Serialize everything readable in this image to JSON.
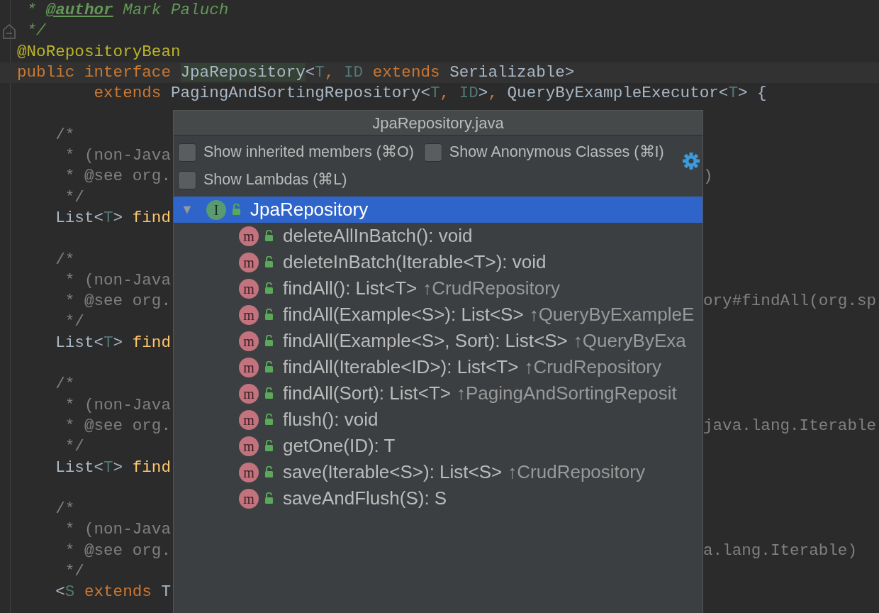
{
  "editor": {
    "lines": [
      {
        "tokens": [
          {
            "kind": "doc",
            "text": " * "
          },
          {
            "kind": "doctag",
            "text": "@author"
          },
          {
            "kind": "doc",
            "text": " Mark Paluch"
          }
        ]
      },
      {
        "fold": true,
        "tokens": [
          {
            "kind": "doc",
            "text": " */"
          }
        ]
      },
      {
        "tokens": [
          {
            "kind": "annotation",
            "text": "@NoRepositoryBean"
          }
        ]
      },
      {
        "current": true,
        "tokens": [
          {
            "kind": "keyword",
            "text": "public interface "
          },
          {
            "kind": "symbol",
            "text": "JpaRepository"
          },
          {
            "kind": "plain",
            "text": "<"
          },
          {
            "kind": "typeparam",
            "text": "T"
          },
          {
            "kind": "keyword",
            "text": ", "
          },
          {
            "kind": "typeparam",
            "text": "ID"
          },
          {
            "kind": "keyword",
            "text": " extends "
          },
          {
            "kind": "plain",
            "text": "Serializable>"
          }
        ]
      },
      {
        "tokens": [
          {
            "kind": "keyword",
            "text": "        extends "
          },
          {
            "kind": "plain",
            "text": "PagingAndSortingRepository<"
          },
          {
            "kind": "typeparam",
            "text": "T"
          },
          {
            "kind": "keyword",
            "text": ", "
          },
          {
            "kind": "typeparam",
            "text": "ID"
          },
          {
            "kind": "plain",
            "text": ">"
          },
          {
            "kind": "keyword",
            "text": ", "
          },
          {
            "kind": "plain",
            "text": "QueryByExampleExecutor<"
          },
          {
            "kind": "typeparam",
            "text": "T"
          },
          {
            "kind": "plain",
            "text": "> {"
          }
        ]
      },
      {
        "space_before": true,
        "tokens": [
          {
            "kind": "comment",
            "text": "    /*"
          }
        ]
      },
      {
        "tokens": [
          {
            "kind": "comment",
            "text": "     * (non-Java"
          }
        ]
      },
      {
        "tokens": [
          {
            "kind": "comment",
            "text": "     * @see org."
          }
        ],
        "right": ")"
      },
      {
        "tokens": [
          {
            "kind": "comment",
            "text": "     */"
          }
        ]
      },
      {
        "tokens": [
          {
            "kind": "plain",
            "text": "    List<"
          },
          {
            "kind": "typeparam",
            "text": "T"
          },
          {
            "kind": "plain",
            "text": "> "
          },
          {
            "kind": "method",
            "text": "find"
          }
        ]
      },
      {
        "space_before": true,
        "tokens": [
          {
            "kind": "comment",
            "text": "    /*"
          }
        ]
      },
      {
        "tokens": [
          {
            "kind": "comment",
            "text": "     * (non-Java"
          }
        ]
      },
      {
        "tokens": [
          {
            "kind": "comment",
            "text": "     * @see org."
          }
        ],
        "right": "ory#findAll(org.sp"
      },
      {
        "tokens": [
          {
            "kind": "comment",
            "text": "     */"
          }
        ]
      },
      {
        "tokens": [
          {
            "kind": "plain",
            "text": "    List<"
          },
          {
            "kind": "typeparam",
            "text": "T"
          },
          {
            "kind": "plain",
            "text": "> "
          },
          {
            "kind": "method",
            "text": "find"
          }
        ]
      },
      {
        "space_before": true,
        "tokens": [
          {
            "kind": "comment",
            "text": "    /*"
          }
        ]
      },
      {
        "tokens": [
          {
            "kind": "comment",
            "text": "     * (non-Java"
          }
        ]
      },
      {
        "tokens": [
          {
            "kind": "comment",
            "text": "     * @see org."
          }
        ],
        "right": "java.lang.Iterable"
      },
      {
        "tokens": [
          {
            "kind": "comment",
            "text": "     */"
          }
        ]
      },
      {
        "tokens": [
          {
            "kind": "plain",
            "text": "    List<"
          },
          {
            "kind": "typeparam",
            "text": "T"
          },
          {
            "kind": "plain",
            "text": "> "
          },
          {
            "kind": "method",
            "text": "find"
          }
        ]
      },
      {
        "space_before": true,
        "tokens": [
          {
            "kind": "comment",
            "text": "    /*"
          }
        ]
      },
      {
        "tokens": [
          {
            "kind": "comment",
            "text": "     * (non-Java"
          }
        ]
      },
      {
        "tokens": [
          {
            "kind": "comment",
            "text": "     * @see org."
          }
        ],
        "right": "a.lang.Iterable)"
      },
      {
        "tokens": [
          {
            "kind": "comment",
            "text": "     */"
          }
        ]
      },
      {
        "tokens": [
          {
            "kind": "plain",
            "text": "    <"
          },
          {
            "kind": "typeparam",
            "text": "S"
          },
          {
            "kind": "keyword",
            "text": " extends "
          },
          {
            "kind": "plain",
            "text": "T"
          }
        ]
      }
    ]
  },
  "popup": {
    "title": "JpaRepository.java",
    "options": [
      [
        {
          "label": "Show inherited members (⌘O)",
          "checked": false
        },
        {
          "label": "Show Anonymous Classes (⌘I)",
          "checked": false
        }
      ],
      [
        {
          "label": "Show Lambdas (⌘L)",
          "checked": false
        }
      ]
    ],
    "tree": [
      {
        "toggle": "▼",
        "badge": "I",
        "label": "JpaRepository",
        "selected": true,
        "children": [
          {
            "badge": "m",
            "label": "deleteAllInBatch(): void",
            "selected": false
          },
          {
            "badge": "m",
            "label": "deleteInBatch(Iterable<T>): void",
            "selected": false
          },
          {
            "badge": "m",
            "label": "findAll(): List<T>",
            "origin": "↑CrudRepository",
            "selected": false
          },
          {
            "badge": "m",
            "label": "findAll(Example<S>): List<S>",
            "origin": "↑QueryByExampleE",
            "selected": false
          },
          {
            "badge": "m",
            "label": "findAll(Example<S>, Sort): List<S>",
            "origin": "↑QueryByExa",
            "selected": false
          },
          {
            "badge": "m",
            "label": "findAll(Iterable<ID>): List<T>",
            "origin": "↑CrudRepository",
            "selected": false
          },
          {
            "badge": "m",
            "label": "findAll(Sort): List<T>",
            "origin": "↑PagingAndSortingReposit",
            "selected": false
          },
          {
            "badge": "m",
            "label": "flush(): void",
            "selected": false
          },
          {
            "badge": "m",
            "label": "getOne(ID): T",
            "selected": false
          },
          {
            "badge": "m",
            "label": "save(Iterable<S>): List<S>",
            "origin": "↑CrudRepository",
            "selected": false
          },
          {
            "badge": "m",
            "label": "saveAndFlush(S): S",
            "selected": false
          }
        ]
      }
    ]
  }
}
